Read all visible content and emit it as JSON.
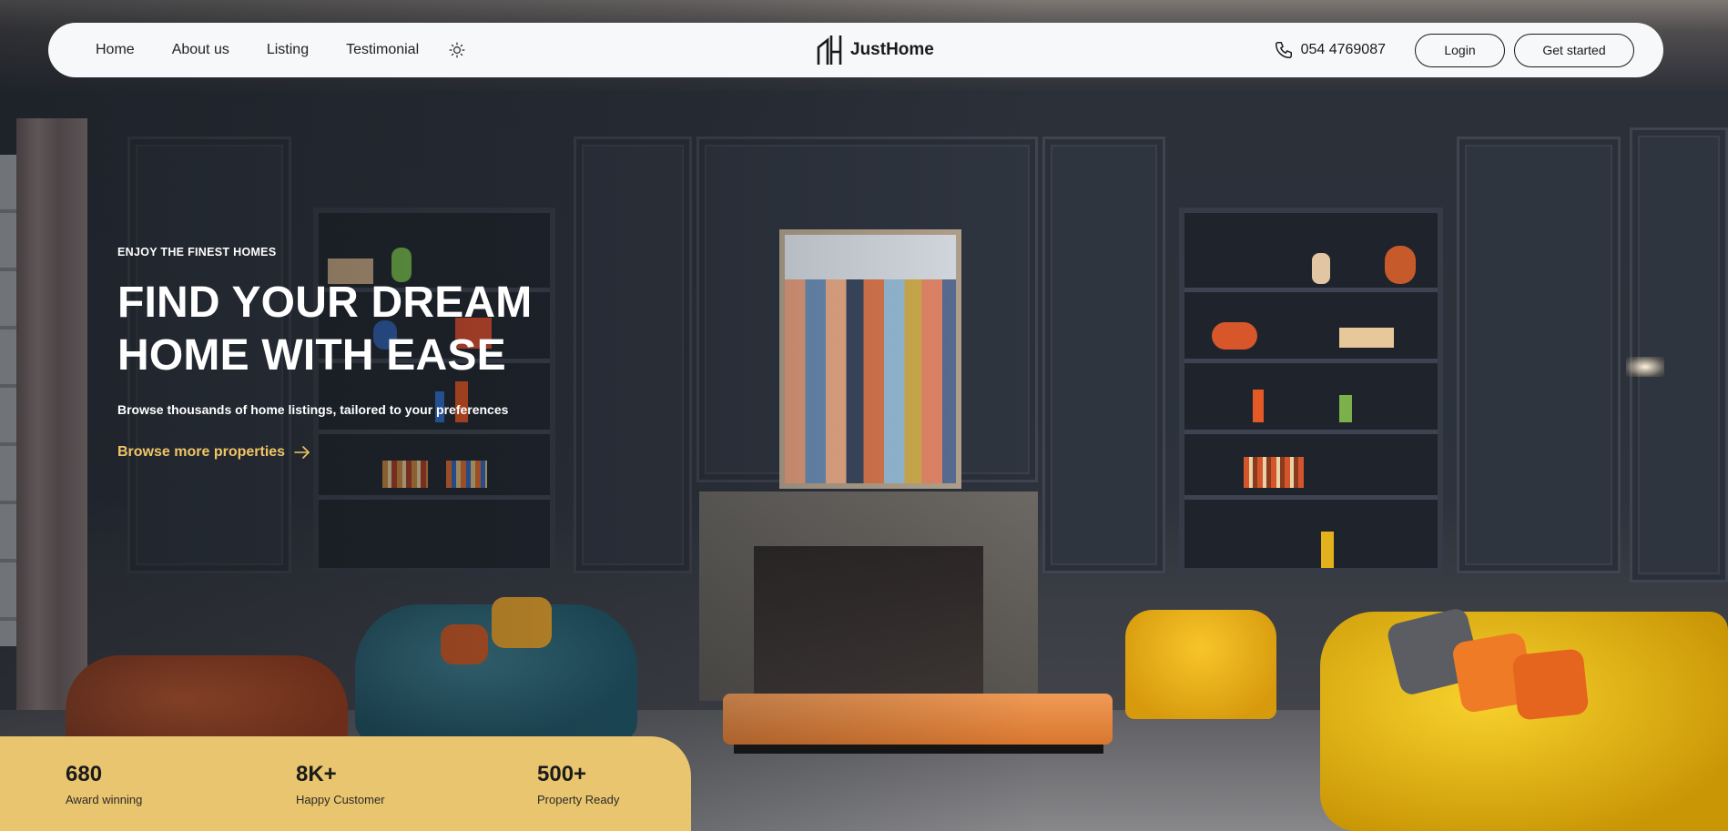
{
  "nav": {
    "links": [
      "Home",
      "About us",
      "Listing",
      "Testimonial"
    ],
    "theme_icon": "sun-icon",
    "brand": "JustHome",
    "phone": "054 4769087",
    "login_label": "Login",
    "get_started_label": "Get started"
  },
  "hero": {
    "eyebrow": "ENJOY THE FINEST HOMES",
    "title": "FIND YOUR DREAM HOME WITH EASE",
    "subtitle": "Browse thousands of home listings, tailored to your preferences",
    "cta_label": "Browse more properties"
  },
  "stats": [
    {
      "value": "680",
      "label": "Award winning"
    },
    {
      "value": "8K+",
      "label": "Happy Customer"
    },
    {
      "value": "500+",
      "label": "Property Ready"
    }
  ],
  "colors": {
    "accent": "#f0c566",
    "stats_bg": "#e8c56e",
    "nav_bg": "#f6f8fa"
  }
}
